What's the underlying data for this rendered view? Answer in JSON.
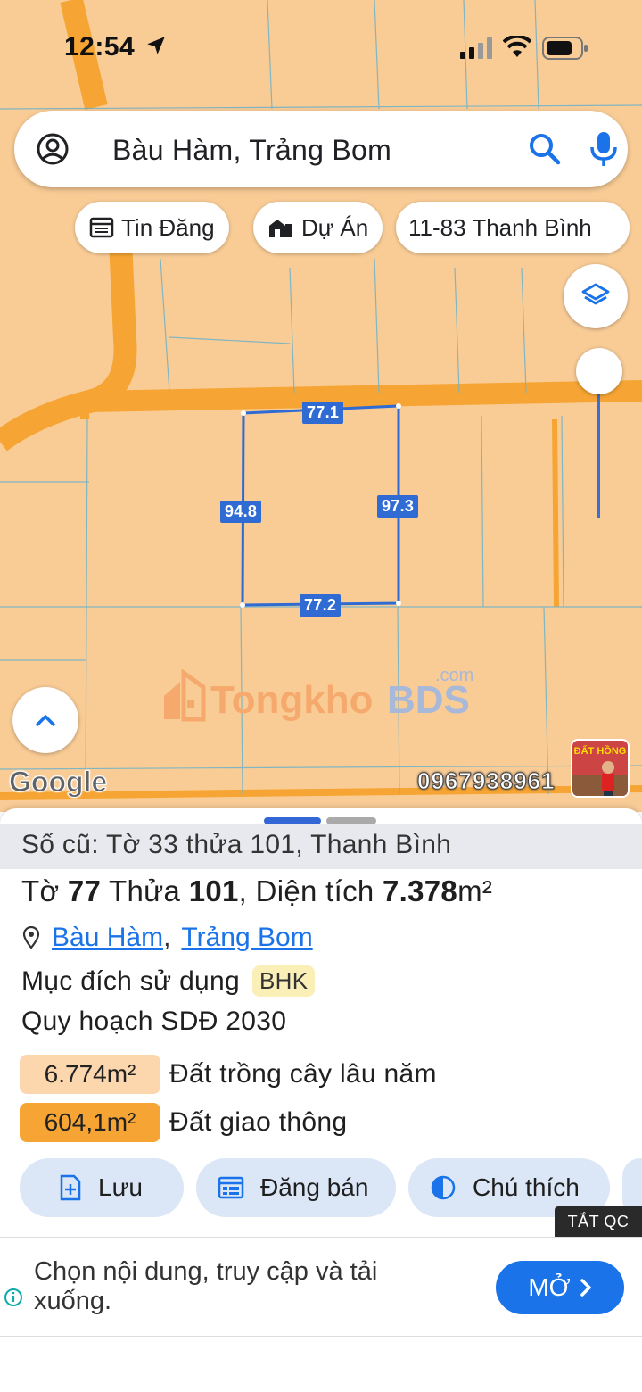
{
  "status_bar": {
    "time": "12:54"
  },
  "search": {
    "query": "Bàu Hàm, Trảng Bom"
  },
  "chips": [
    {
      "label": "Tin Đăng",
      "icon": "calendar-list-icon"
    },
    {
      "label": "Dự Án",
      "icon": "buildings-icon"
    },
    {
      "label": "11-83 Thanh Bình",
      "icon": ""
    }
  ],
  "map": {
    "dimensions": {
      "top": "77.1",
      "left": "94.8",
      "right": "97.3",
      "bottom": "77.2"
    },
    "watermark": {
      "part1": "Tongkho",
      "part2": "BDS",
      "suffix": ".com"
    },
    "google_logo": "Google",
    "phone": "0967938961",
    "thumb_text": "ĐẤT HỒNG",
    "colors": {
      "land": "#f9cc96",
      "road": "#f6a534",
      "parcel_line": "#2f6bd2"
    }
  },
  "sheet": {
    "old_ref": "Số cũ: Tờ 33 thửa 101, Thanh Bình",
    "title": {
      "sheet_label": "Tờ ",
      "sheet_no": "77",
      "parcel_label": " Thửa ",
      "parcel_no": "101",
      "area_label": ", Diện tích ",
      "area_value": "7.378",
      "area_unit": "m²"
    },
    "location": {
      "commune": "Bàu Hàm",
      "separator": ",",
      "district": "Trảng Bom"
    },
    "purpose_label": "Mục đích sử dụng",
    "purpose_code": "BHK",
    "plan_label": "Quy hoạch SDĐ 2030",
    "zones": [
      {
        "area": "6.774m²",
        "label": "Đất trồng cây lâu năm",
        "color": "#fcd6ad"
      },
      {
        "area": "604,1m²",
        "label": "Đất giao thông",
        "color": "#f6a534"
      }
    ],
    "actions": [
      {
        "label": "Lưu",
        "icon": "bookmark-plus-icon"
      },
      {
        "label": "Đăng bán",
        "icon": "calendar-list-icon"
      },
      {
        "label": "Chú thích",
        "icon": "half-circle-icon"
      }
    ]
  },
  "ad": {
    "close_label": "TẮT QC",
    "text": "Chọn nội dung, truy cập và tải xuống.",
    "cta_label": "MỞ"
  }
}
